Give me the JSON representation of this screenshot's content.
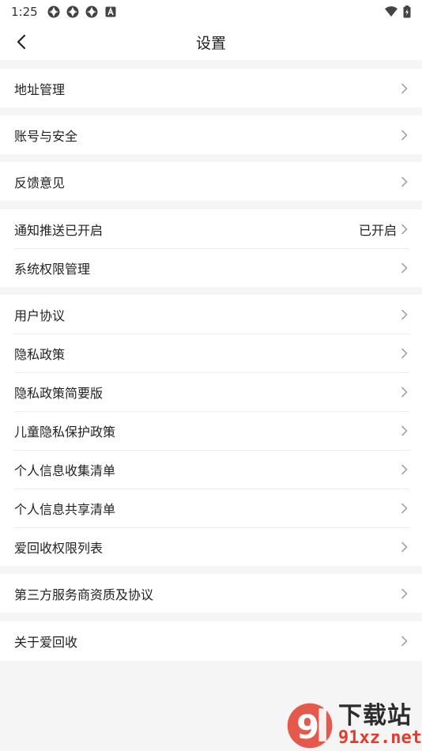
{
  "status_bar": {
    "time": "1:25"
  },
  "header": {
    "title": "设置"
  },
  "groups": [
    {
      "items": [
        {
          "label": "地址管理"
        }
      ]
    },
    {
      "items": [
        {
          "label": "账号与安全"
        }
      ]
    },
    {
      "items": [
        {
          "label": "反馈意见"
        }
      ]
    },
    {
      "items": [
        {
          "label": "通知推送已开启",
          "value": "已开启"
        },
        {
          "label": "系统权限管理"
        }
      ]
    },
    {
      "items": [
        {
          "label": "用户协议"
        },
        {
          "label": "隐私政策"
        },
        {
          "label": "隐私政策简要版"
        },
        {
          "label": "儿童隐私保护政策"
        },
        {
          "label": "个人信息收集清单"
        },
        {
          "label": "个人信息共享清单"
        },
        {
          "label": "爱回收权限列表"
        }
      ]
    },
    {
      "items": [
        {
          "label": "第三方服务商资质及协议"
        }
      ]
    },
    {
      "items": [
        {
          "label": "关于爱回收"
        }
      ]
    }
  ],
  "watermark": {
    "brand": "下载站",
    "url": "91xz.net"
  },
  "colors": {
    "background": "#f5f5f5",
    "surface": "#ffffff",
    "text": "#222222",
    "chevron": "#9a9a9a",
    "watermark_red": "#e23c2e"
  }
}
